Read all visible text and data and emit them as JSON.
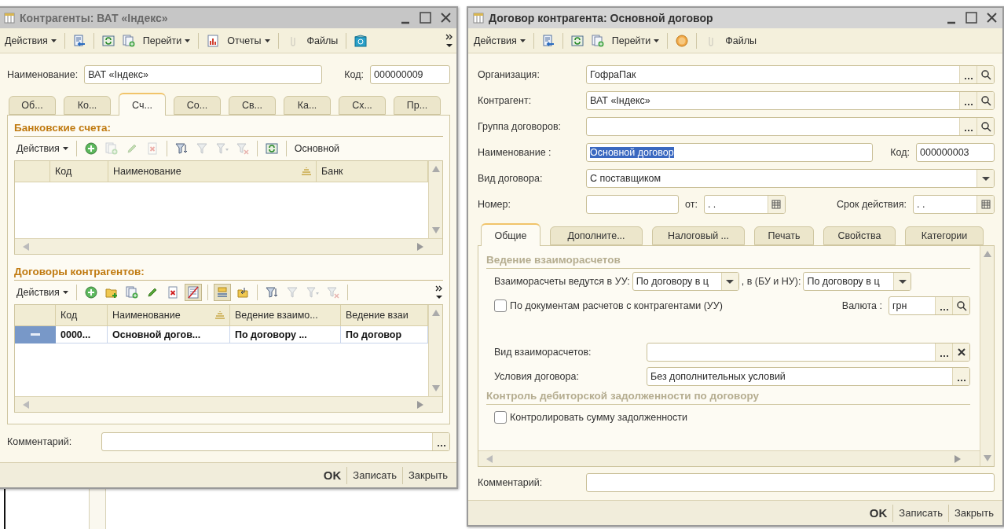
{
  "counterparty_window": {
    "title": "Контрагенты: ВАТ «Індекс»",
    "active": false,
    "toolbar": [
      {
        "kind": "menu",
        "label": "Действия"
      },
      {
        "kind": "separator"
      },
      {
        "kind": "icon",
        "disabled": false
      },
      {
        "kind": "separator"
      },
      {
        "kind": "icon",
        "disabled": false
      },
      {
        "kind": "icon",
        "disabled": false
      },
      {
        "kind": "menu",
        "label": "Перейти"
      },
      {
        "kind": "separator"
      },
      {
        "kind": "icon",
        "disabled": false
      },
      {
        "kind": "menu",
        "label": "Отчеты"
      },
      {
        "kind": "separator"
      },
      {
        "kind": "icon",
        "disabled": true
      },
      {
        "kind": "button",
        "label": "Файлы"
      },
      {
        "kind": "separator"
      },
      {
        "kind": "icon",
        "disabled": false
      },
      {
        "kind": "overflow"
      }
    ],
    "name": {
      "label": "Наименование:",
      "value": "ВАТ «Індекс»"
    },
    "code": {
      "label": "Код:",
      "value": "000000009"
    },
    "tabs": [
      {
        "label": "Об...",
        "selected": false
      },
      {
        "label": "Ко...",
        "selected": false
      },
      {
        "label": "Сч...",
        "selected": true
      },
      {
        "label": "Со...",
        "selected": false
      },
      {
        "label": "Св...",
        "selected": false
      },
      {
        "label": "Ка...",
        "selected": false
      },
      {
        "label": "Сх...",
        "selected": false
      },
      {
        "label": "Пр...",
        "selected": false
      }
    ],
    "bank_accounts": {
      "title": "Банковские счета:",
      "toolbar": [
        {
          "kind": "menu",
          "label": "Действия"
        },
        {
          "kind": "separator"
        },
        {
          "kind": "icon",
          "disabled": false
        },
        {
          "kind": "icon",
          "disabled": true
        },
        {
          "kind": "icon",
          "disabled": true
        },
        {
          "kind": "icon",
          "disabled": true
        },
        {
          "kind": "separator"
        },
        {
          "kind": "icon",
          "disabled": false
        },
        {
          "kind": "icon",
          "disabled": true
        },
        {
          "kind": "icon",
          "disabled": true
        },
        {
          "kind": "icon",
          "disabled": true
        },
        {
          "kind": "separator"
        },
        {
          "kind": "icon",
          "disabled": false
        },
        {
          "kind": "separator"
        },
        {
          "kind": "button",
          "label": "Основной"
        }
      ],
      "columns": [
        {
          "label": "Код",
          "sorted": false
        },
        {
          "label": "Наименование",
          "sorted": true
        },
        {
          "label": "Банк",
          "sorted": false
        }
      ]
    },
    "contracts": {
      "title": "Договоры контрагентов:",
      "toolbar": [
        {
          "kind": "menu",
          "label": "Действия"
        },
        {
          "kind": "separator"
        },
        {
          "kind": "icon",
          "disabled": false,
          "pressed": false
        },
        {
          "kind": "icon",
          "disabled": false,
          "pressed": false
        },
        {
          "kind": "icon",
          "disabled": false,
          "pressed": false
        },
        {
          "kind": "icon",
          "disabled": false,
          "pressed": false
        },
        {
          "kind": "icon",
          "disabled": false,
          "pressed": false
        },
        {
          "kind": "icon",
          "disabled": false,
          "pressed": true
        },
        {
          "kind": "separator"
        },
        {
          "kind": "icon",
          "disabled": false,
          "pressed": true
        },
        {
          "kind": "icon",
          "disabled": false,
          "pressed": false
        },
        {
          "kind": "separator"
        },
        {
          "kind": "icon",
          "disabled": false,
          "pressed": false
        },
        {
          "kind": "icon",
          "disabled": true,
          "pressed": false
        },
        {
          "kind": "icon",
          "disabled": true,
          "pressed": false
        },
        {
          "kind": "icon",
          "disabled": true,
          "pressed": false
        },
        {
          "kind": "separator"
        },
        {
          "kind": "overflow"
        }
      ],
      "columns": [
        {
          "label": "Код",
          "sorted": false
        },
        {
          "label": "Наименование",
          "sorted": true
        },
        {
          "label": "Ведение взаимо...",
          "sorted": false
        },
        {
          "label": "Ведение взаи",
          "sorted": false
        }
      ],
      "rows": [
        {
          "selected": true,
          "cells": [
            "0000...",
            "Основной догов...",
            "По договору ...",
            "По договор"
          ]
        }
      ]
    },
    "comment": {
      "label": "Комментарий:"
    },
    "buttons": [
      {
        "label": "OK",
        "default": true
      },
      {
        "label": "Записать",
        "default": false
      },
      {
        "label": "Закрыть",
        "default": false
      }
    ]
  },
  "contract_window": {
    "title": "Договор контрагента: Основной договор",
    "active": true,
    "toolbar": [
      {
        "kind": "menu",
        "label": "Действия"
      },
      {
        "kind": "separator"
      },
      {
        "kind": "icon",
        "disabled": false
      },
      {
        "kind": "separator"
      },
      {
        "kind": "icon",
        "disabled": false
      },
      {
        "kind": "icon",
        "disabled": false
      },
      {
        "kind": "menu",
        "label": "Перейти"
      },
      {
        "kind": "separator"
      },
      {
        "kind": "icon",
        "disabled": false
      },
      {
        "kind": "separator"
      },
      {
        "kind": "icon",
        "disabled": true
      },
      {
        "kind": "button",
        "label": "Файлы"
      }
    ],
    "organization": {
      "label": "Организация:",
      "value": "ГофраПак"
    },
    "counterparty": {
      "label": "Контрагент:",
      "value": "ВАТ «Індекс»"
    },
    "contract_group": {
      "label": "Группа договоров:"
    },
    "name": {
      "label": "Наименование :",
      "value": "Основной договор",
      "text_selected": true
    },
    "code": {
      "label": "Код:",
      "value": "000000003"
    },
    "contract_type": {
      "label": "Вид договора:",
      "value": "С поставщиком"
    },
    "number": {
      "label": "Номер:"
    },
    "date": {
      "label": "от:",
      "value": ". ."
    },
    "validity": {
      "label": "Срок действия:",
      "value": ". ."
    },
    "tabs": [
      {
        "label": "Общие",
        "selected": true
      },
      {
        "label": "Дополните...",
        "selected": false
      },
      {
        "label": "Налоговый ...",
        "selected": false
      },
      {
        "label": "Печать",
        "selected": false
      },
      {
        "label": "Свойства",
        "selected": false
      },
      {
        "label": "Категории",
        "selected": false
      }
    ],
    "settlements": {
      "title": "Ведение взаиморасчетов",
      "mgmt_label": "Взаиморасчеты ведутся в УУ:",
      "mgmt_value": "По договору в ц",
      "acct_label": ", в (БУ и НУ):",
      "acct_value": "По договору в ц",
      "by_documents": {
        "label": "По документам расчетов с контрагентами (УУ)",
        "checked": false
      },
      "currency": {
        "label": "Валюта :",
        "value": "грн"
      },
      "settlement_type": {
        "label": "Вид взаиморасчетов:"
      },
      "terms": {
        "label": "Условия договора:",
        "value": "Без дополнительных условий"
      }
    },
    "receivables": {
      "title": "Контроль дебиторской задолженности по договору",
      "control_sum": {
        "label": "Контролировать сумму задолженности",
        "checked": false
      }
    },
    "comment": {
      "label": "Комментарий:"
    },
    "buttons": [
      {
        "label": "OK",
        "default": true
      },
      {
        "label": "Записать",
        "default": false
      },
      {
        "label": "Закрыть",
        "default": false
      }
    ]
  }
}
